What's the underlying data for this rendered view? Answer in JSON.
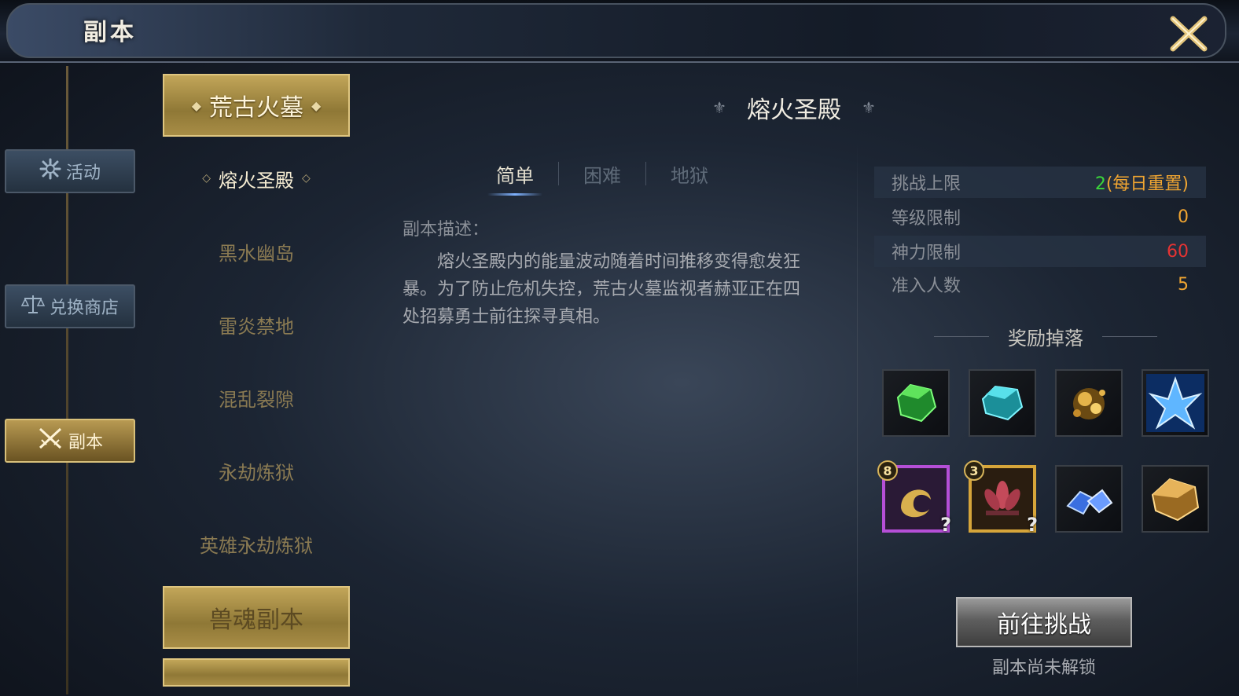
{
  "window": {
    "title": "副本"
  },
  "sidebar": {
    "items": [
      {
        "label": "活动",
        "icon": "gear-flower-icon",
        "active": false
      },
      {
        "label": "兑换商店",
        "icon": "scale-icon",
        "active": false
      },
      {
        "label": "副本",
        "icon": "crossed-swords-icon",
        "active": true
      }
    ]
  },
  "categories": {
    "top_header": "荒古火墓",
    "sub_items": [
      "熔火圣殿",
      "黑水幽岛",
      "雷炎禁地",
      "混乱裂隙",
      "永劫炼狱",
      "英雄永劫炼狱"
    ],
    "selected_index": 0,
    "bottom_header": "兽魂副本"
  },
  "main": {
    "dungeon_title": "熔火圣殿",
    "difficulty_tabs": [
      "简单",
      "困难",
      "地狱"
    ],
    "active_tab": 0,
    "description_label": "副本描述：",
    "description": "熔火圣殿内的能量波动随着时间推移变得愈发狂暴。为了防止危机失控，荒古火墓监视者赫亚正在四处招募勇士前往探寻真相。"
  },
  "stats": {
    "challenge_limit_label": "挑战上限",
    "challenge_limit_value": "2",
    "challenge_limit_suffix": "(每日重置)",
    "level_limit_label": "等级限制",
    "level_limit_value": "0",
    "power_limit_label": "神力限制",
    "power_limit_value": "60",
    "players_label": "准入人数",
    "players_value": "5"
  },
  "rewards": {
    "title": "奖励掉落",
    "row1": [
      {
        "icon": "green-gem-icon"
      },
      {
        "icon": "cyan-gem-icon"
      },
      {
        "icon": "gold-ore-icon"
      },
      {
        "icon": "ice-crystal-icon"
      }
    ],
    "row2": [
      {
        "icon": "phoenix-emblem-icon",
        "badge": "8",
        "frame": "purple",
        "unknown": true
      },
      {
        "icon": "lotus-emblem-icon",
        "badge": "3",
        "frame": "gold",
        "unknown": true
      },
      {
        "icon": "blue-crystals-icon"
      },
      {
        "icon": "amber-stone-icon"
      }
    ]
  },
  "actions": {
    "challenge_button": "前往挑战",
    "lock_text": "副本尚未解锁"
  },
  "colors": {
    "accent_gold": "#c2a659",
    "stat_orange": "#f0a531",
    "stat_green": "#3ad63a",
    "stat_red": "#e53333",
    "purple_frame": "#b54fd7",
    "gold_frame": "#d6a53a"
  }
}
